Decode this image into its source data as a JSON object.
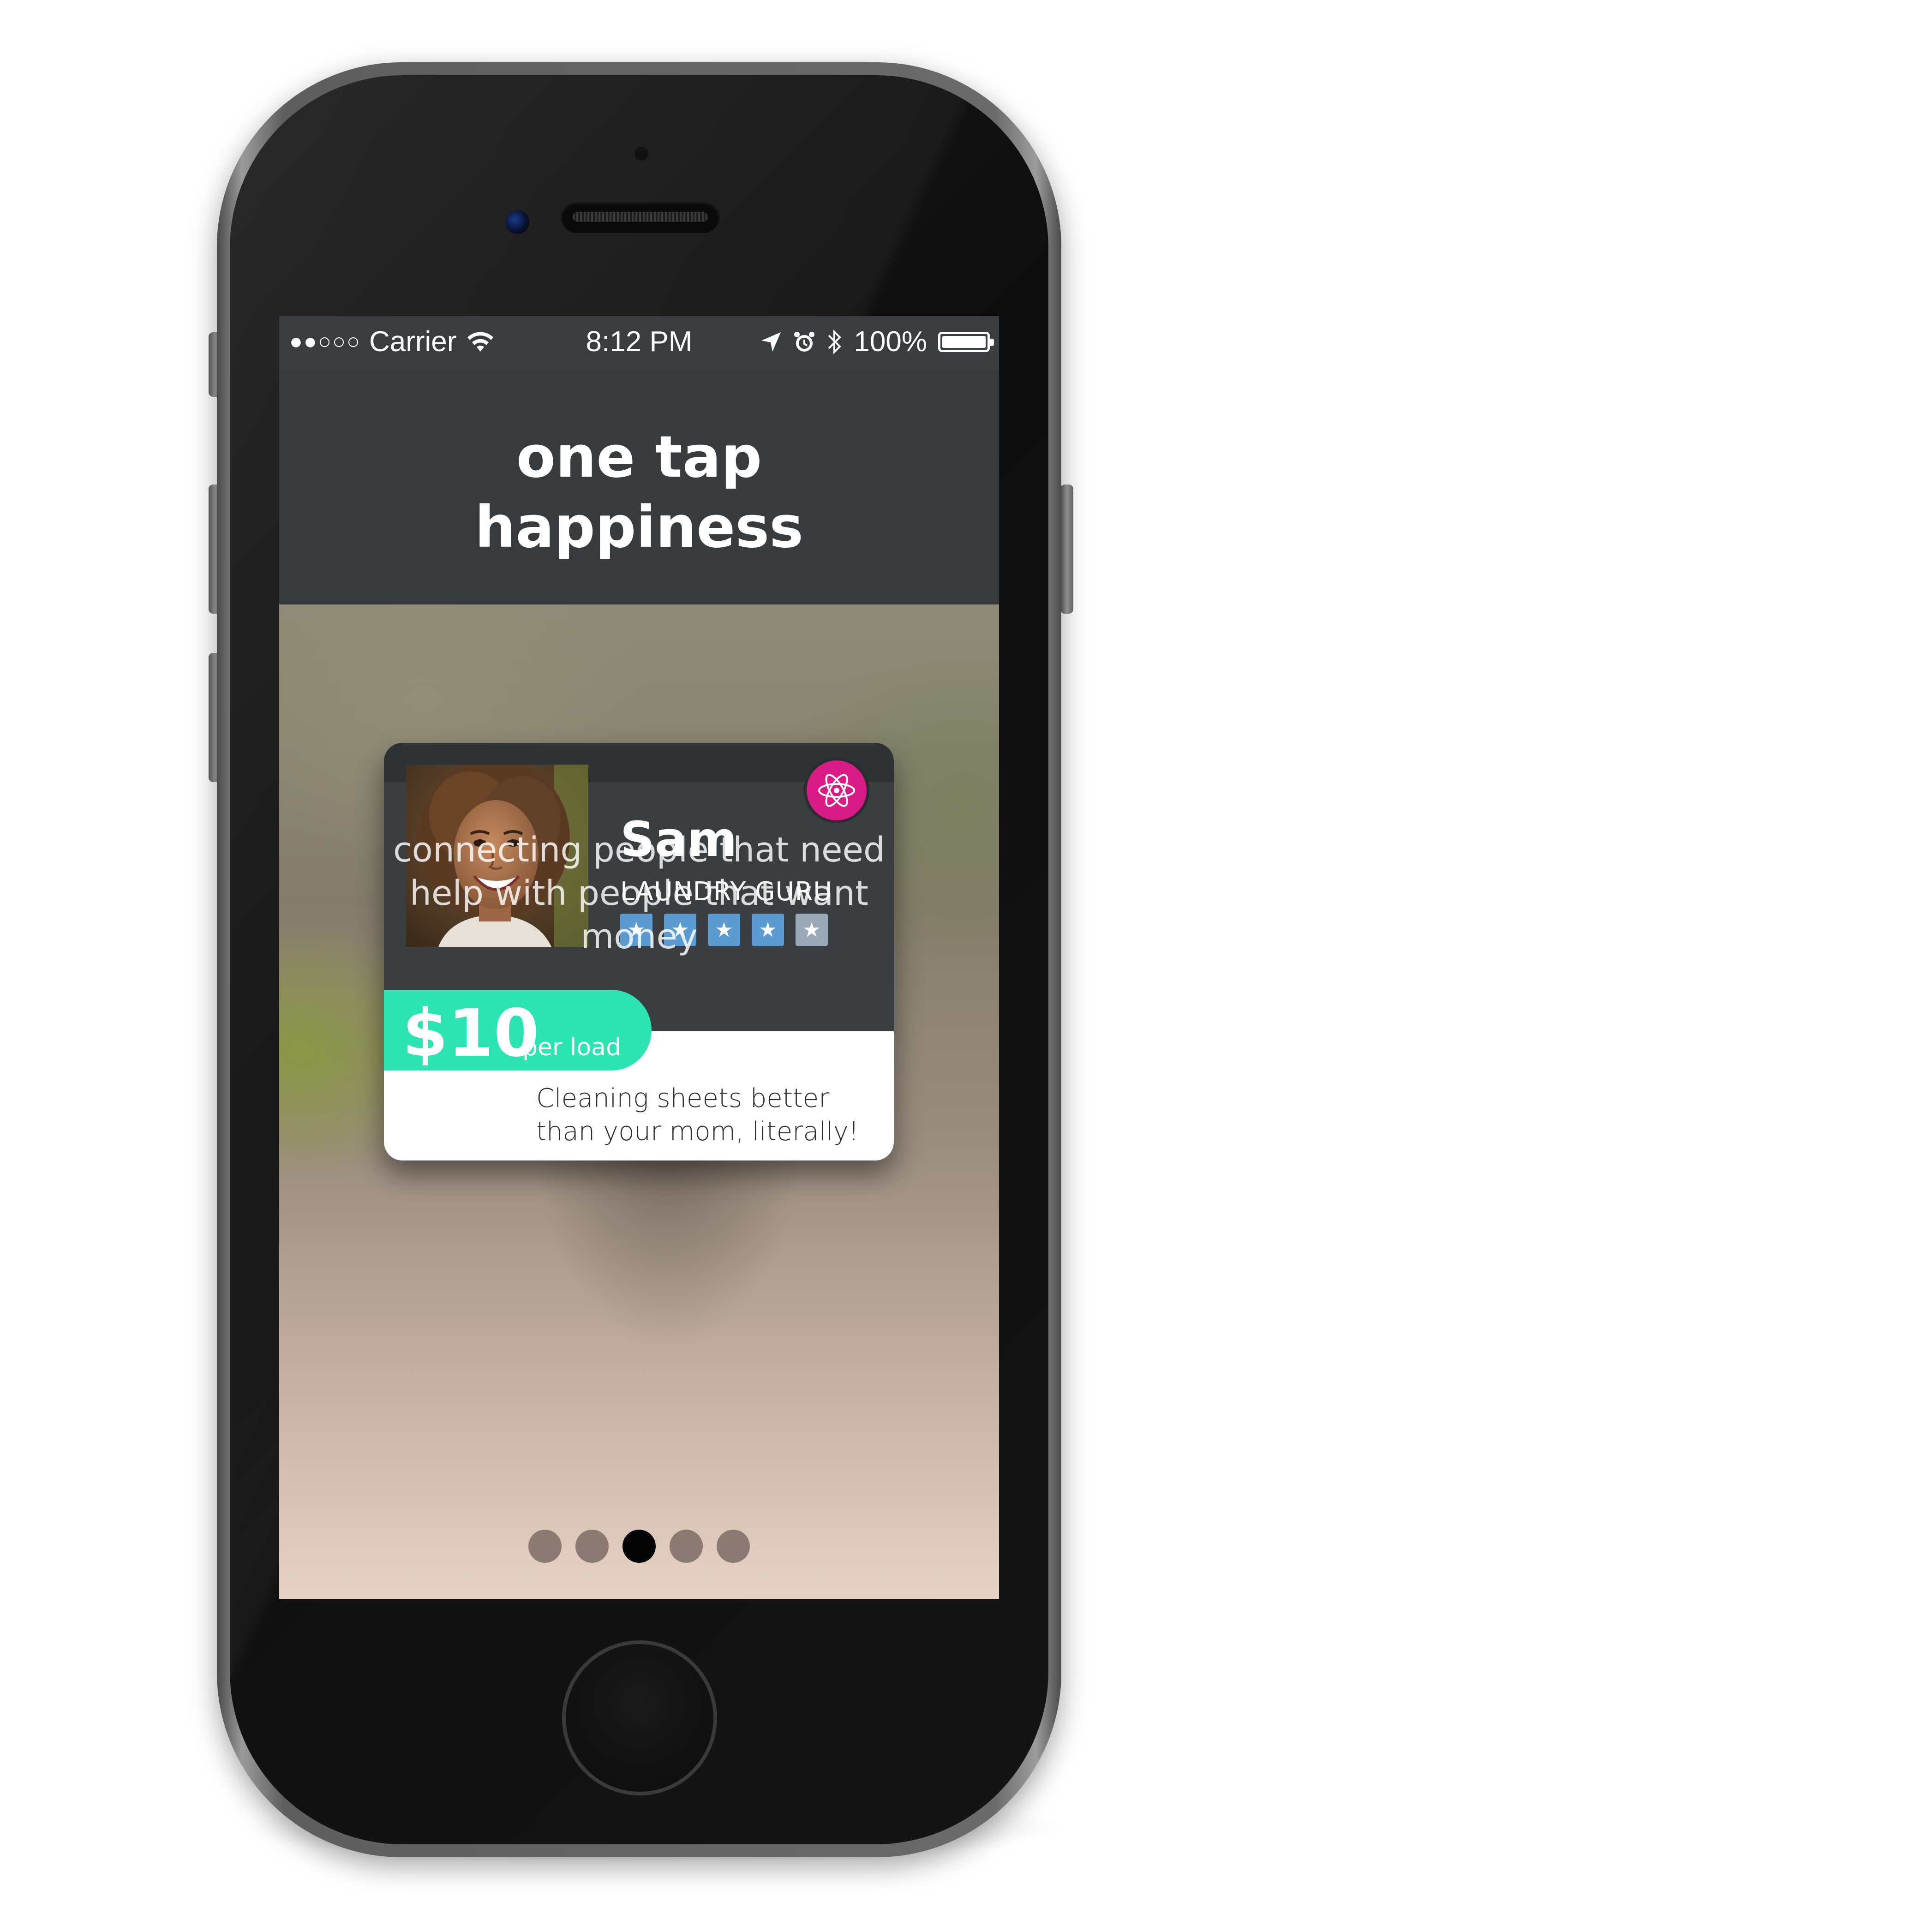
{
  "status_bar": {
    "signal": "●●○○○",
    "carrier": "Carrier",
    "time": "8:12 PM",
    "battery": "100%",
    "battery_level": 1.0,
    "icons": [
      "wifi-icon",
      "location-arrow-icon",
      "alarm-icon",
      "bluetooth-icon",
      "battery-icon"
    ]
  },
  "header": {
    "title": "one tap\nhappiness"
  },
  "card": {
    "name": "Sam",
    "role": "LAUNDRY GURU",
    "rating": 5,
    "stars": [
      "★",
      "★",
      "★",
      "★",
      "★"
    ],
    "badge_icon": "atom-icon",
    "price": "$10",
    "price_unit": "per load",
    "description": "Cleaning sheets better than your mom, literally!",
    "colors": {
      "card": "#3b3e41",
      "price_pill": "#2be4b2",
      "badge": "#d81b85",
      "star": "#5b9bd2"
    }
  },
  "tagline": "connecting people that need help with people that want money",
  "pager": {
    "total": 5,
    "active_index": 2
  }
}
